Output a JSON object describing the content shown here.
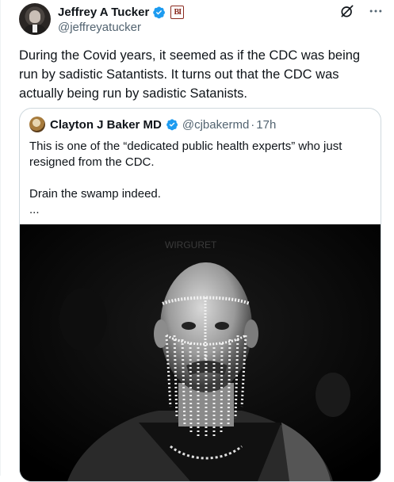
{
  "tweet": {
    "author_name": "Jeffrey A Tucker",
    "author_handle": "@jeffreyatucker",
    "org_badge_letters": "BI",
    "text": "During the Covid years, it seemed as if the CDC was being run by sadistic Satantists. It turns out that the CDC was actually being run by sadistic Satanists."
  },
  "quoted_tweet": {
    "author_name": "Clayton J Baker MD",
    "author_handle": "@cjbakermd",
    "separator": "·",
    "time": "17h",
    "text": "This is one of the “dedicated public health experts” who just resigned from the CDC.\n\nDrain the swamp indeed.\n...",
    "photo_caption_fragment": "WIRGURET"
  },
  "colors": {
    "verified_blue": "#1d9bf0",
    "text_primary": "#0f1419",
    "text_secondary": "#536471",
    "border": "#cfd9de"
  },
  "icons": [
    "verified-badge-icon",
    "grok-icon",
    "more-icon"
  ]
}
